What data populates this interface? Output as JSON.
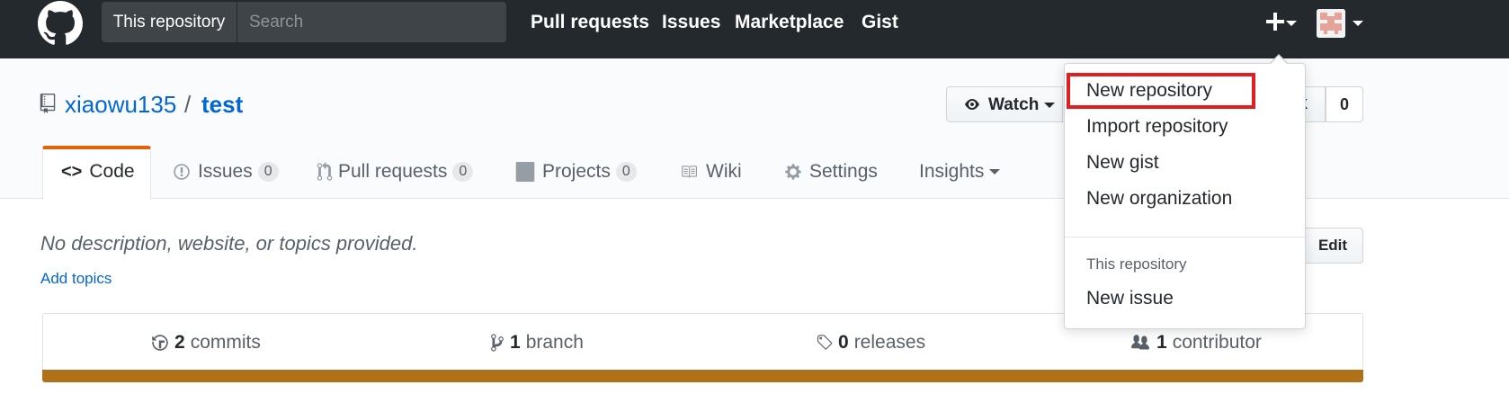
{
  "header": {
    "search_scope": "This repository",
    "search_placeholder": "Search",
    "nav": [
      "Pull requests",
      "Issues",
      "Marketplace",
      "Gist"
    ]
  },
  "repo": {
    "owner": "xiaowu135",
    "separator": "/",
    "name": "test",
    "watch_label": "Watch",
    "fork_fragment": "k",
    "fork_count": "0"
  },
  "tabs": [
    {
      "label": "Code",
      "icon": "code-icon"
    },
    {
      "label": "Issues",
      "count": "0",
      "icon": "issue-opened-icon"
    },
    {
      "label": "Pull requests",
      "count": "0",
      "icon": "git-pull-request-icon"
    },
    {
      "label": "Projects",
      "count": "0",
      "icon": "project-icon"
    },
    {
      "label": "Wiki",
      "icon": "book-icon"
    },
    {
      "label": "Settings",
      "icon": "gear-icon"
    },
    {
      "label": "Insights",
      "icon": "triangle-down-icon"
    }
  ],
  "about": {
    "description": "No description, website, or topics provided.",
    "add_topics": "Add topics",
    "edit_label": "Edit"
  },
  "summary": {
    "commits_count": "2",
    "commits_label": "commits",
    "branch_count": "1",
    "branch_label": "branch",
    "releases_count": "0",
    "releases_label": "releases",
    "contributor_count": "1",
    "contributor_label": "contributor",
    "language_color": "#b07219"
  },
  "dropdown": {
    "items": [
      "New repository",
      "Import repository",
      "New gist",
      "New organization"
    ],
    "section_header": "This repository",
    "section_items": [
      "New issue"
    ]
  },
  "colors": {
    "header_bg": "#24292e",
    "link": "#0366d6",
    "tab_accent": "#e36209",
    "highlight_box": "#e02020"
  }
}
